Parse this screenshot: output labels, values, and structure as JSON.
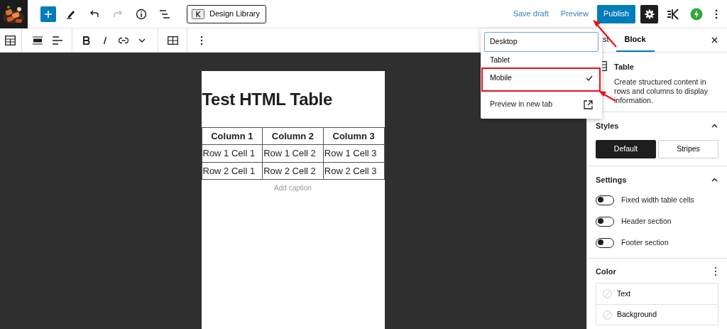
{
  "top_bar": {
    "library_button": "Design Library",
    "save_draft": "Save draft",
    "preview": "Preview",
    "publish": "Publish"
  },
  "editor": {
    "title": "Test HTML Table",
    "table": {
      "columns": [
        "Column 1",
        "Column 2",
        "Column 3"
      ],
      "rows": [
        [
          "Row 1 Cell 1",
          "Row 1 Cell 2",
          "Row 1 Cell 3"
        ],
        [
          "Row 2 Cell 1",
          "Row 2 Cell 2",
          "Row 2 Cell 3"
        ]
      ]
    },
    "caption": {
      "placeholder": "Add caption"
    }
  },
  "preview_menu": {
    "items": [
      {
        "label": "Desktop",
        "selected": false,
        "focused": true
      },
      {
        "label": "Tablet",
        "selected": false,
        "focused": false
      },
      {
        "label": "Mobile",
        "selected": true,
        "focused": false
      }
    ],
    "new_tab_link": "Preview in new tab"
  },
  "sidebar": {
    "tabs": [
      {
        "label": "st",
        "selected": false
      },
      {
        "label": "Block",
        "selected": true
      }
    ],
    "block": {
      "name": "Table",
      "description": "Create structured content in rows and columns to display information."
    },
    "styles": {
      "title": "Styles",
      "expanded": true,
      "options": [
        {
          "label": "Default",
          "selected": true
        },
        {
          "label": "Stripes",
          "selected": false
        }
      ]
    },
    "settings": {
      "title": "Settings",
      "expanded": true,
      "toggles": [
        {
          "label": "Fixed width table cells",
          "on": false
        },
        {
          "label": "Header section",
          "on": false
        },
        {
          "label": "Footer section",
          "on": false
        }
      ]
    },
    "color": {
      "title": "Color",
      "items": [
        {
          "label": "Text"
        },
        {
          "label": "Background"
        }
      ]
    }
  }
}
